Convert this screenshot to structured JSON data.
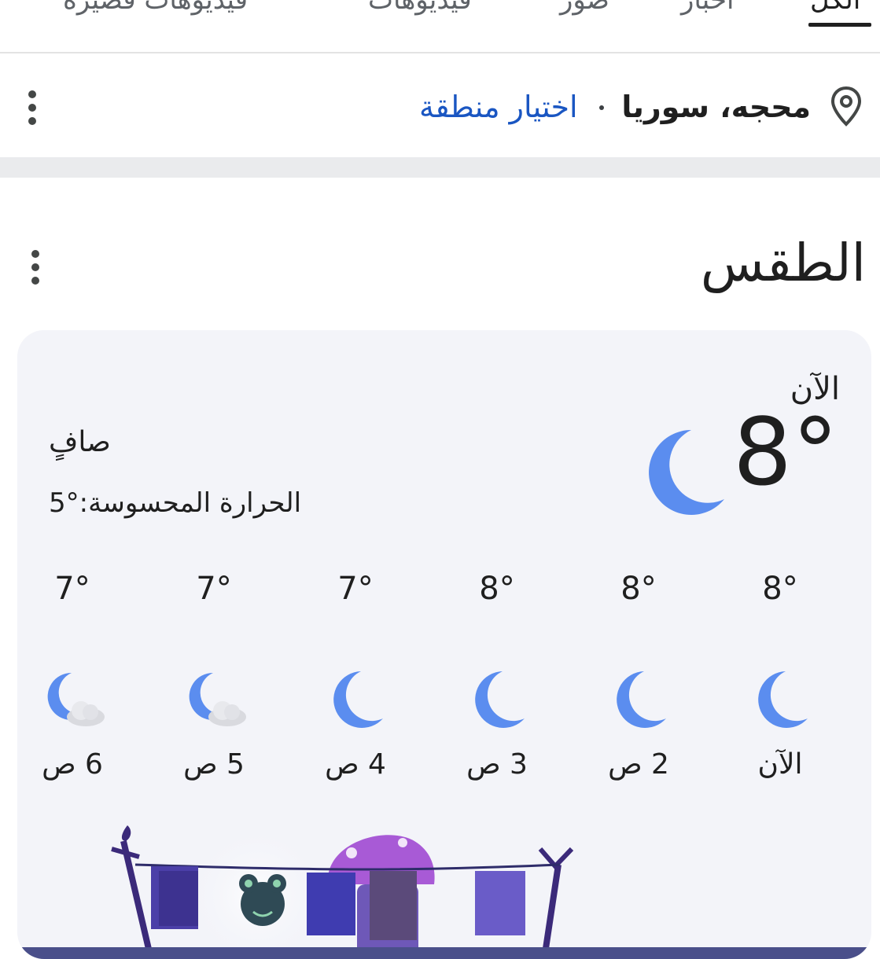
{
  "tabs": [
    {
      "label": "فيديوهات قصيرة",
      "active": false
    },
    {
      "label": "فيديوهات",
      "active": false
    },
    {
      "label": "صور",
      "active": false
    },
    {
      "label": "أخبار",
      "active": false
    },
    {
      "label": "الكل",
      "active": true
    }
  ],
  "location": {
    "city": "محجه، سوريا",
    "choose_region": "اختيار منطقة"
  },
  "weather": {
    "title": "الطقس",
    "now_label": "الآن",
    "current_temp": "8°",
    "condition": "صافٍ",
    "feels_like": "الحرارة المحسوسة:°5",
    "current_icon": "moon-icon",
    "hourly": [
      {
        "time": "الآن",
        "temp": "8°",
        "icon": "moon-icon"
      },
      {
        "time": "2 ص",
        "temp": "8°",
        "icon": "moon-icon"
      },
      {
        "time": "3 ص",
        "temp": "8°",
        "icon": "moon-icon"
      },
      {
        "time": "4 ص",
        "temp": "7°",
        "icon": "moon-icon"
      },
      {
        "time": "5 ص",
        "temp": "7°",
        "icon": "moon-cloud-icon"
      },
      {
        "time": "6 ص",
        "temp": "7°",
        "icon": "moon-cloud-icon"
      }
    ]
  },
  "colors": {
    "accent_link": "#1a56c2",
    "moon": "#5b8def",
    "card_bg": "#f3f4f9"
  }
}
